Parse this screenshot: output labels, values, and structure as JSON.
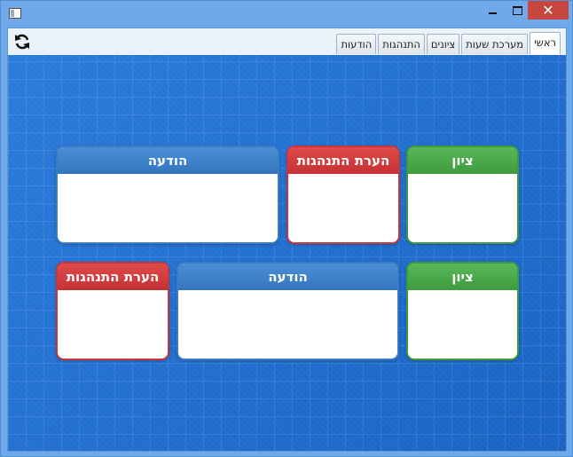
{
  "window": {
    "controls": {
      "minimize_icon": "minimize-icon",
      "maximize_icon": "maximize-icon",
      "close_icon": "close-icon",
      "close_glyph": "✕"
    }
  },
  "toolbar": {
    "refresh_icon": "refresh-icon"
  },
  "tabs": [
    {
      "label": "ראשי",
      "active": true
    },
    {
      "label": "מערכת שעות",
      "active": false
    },
    {
      "label": "ציונים",
      "active": false
    },
    {
      "label": "התנהגות",
      "active": false
    },
    {
      "label": "הודעות",
      "active": false
    }
  ],
  "cards": [
    {
      "title": "ציון",
      "color": "#4aa84a"
    },
    {
      "title": "הערת התנהגות",
      "color": "#d23c3f"
    },
    {
      "title": "הודעה",
      "color": "#3f83c8"
    },
    {
      "title": "ציון",
      "color": "#4aa84a"
    },
    {
      "title": "הודעה",
      "color": "#3f83c8"
    },
    {
      "title": "הערת התנהגות",
      "color": "#d23c3f"
    }
  ]
}
